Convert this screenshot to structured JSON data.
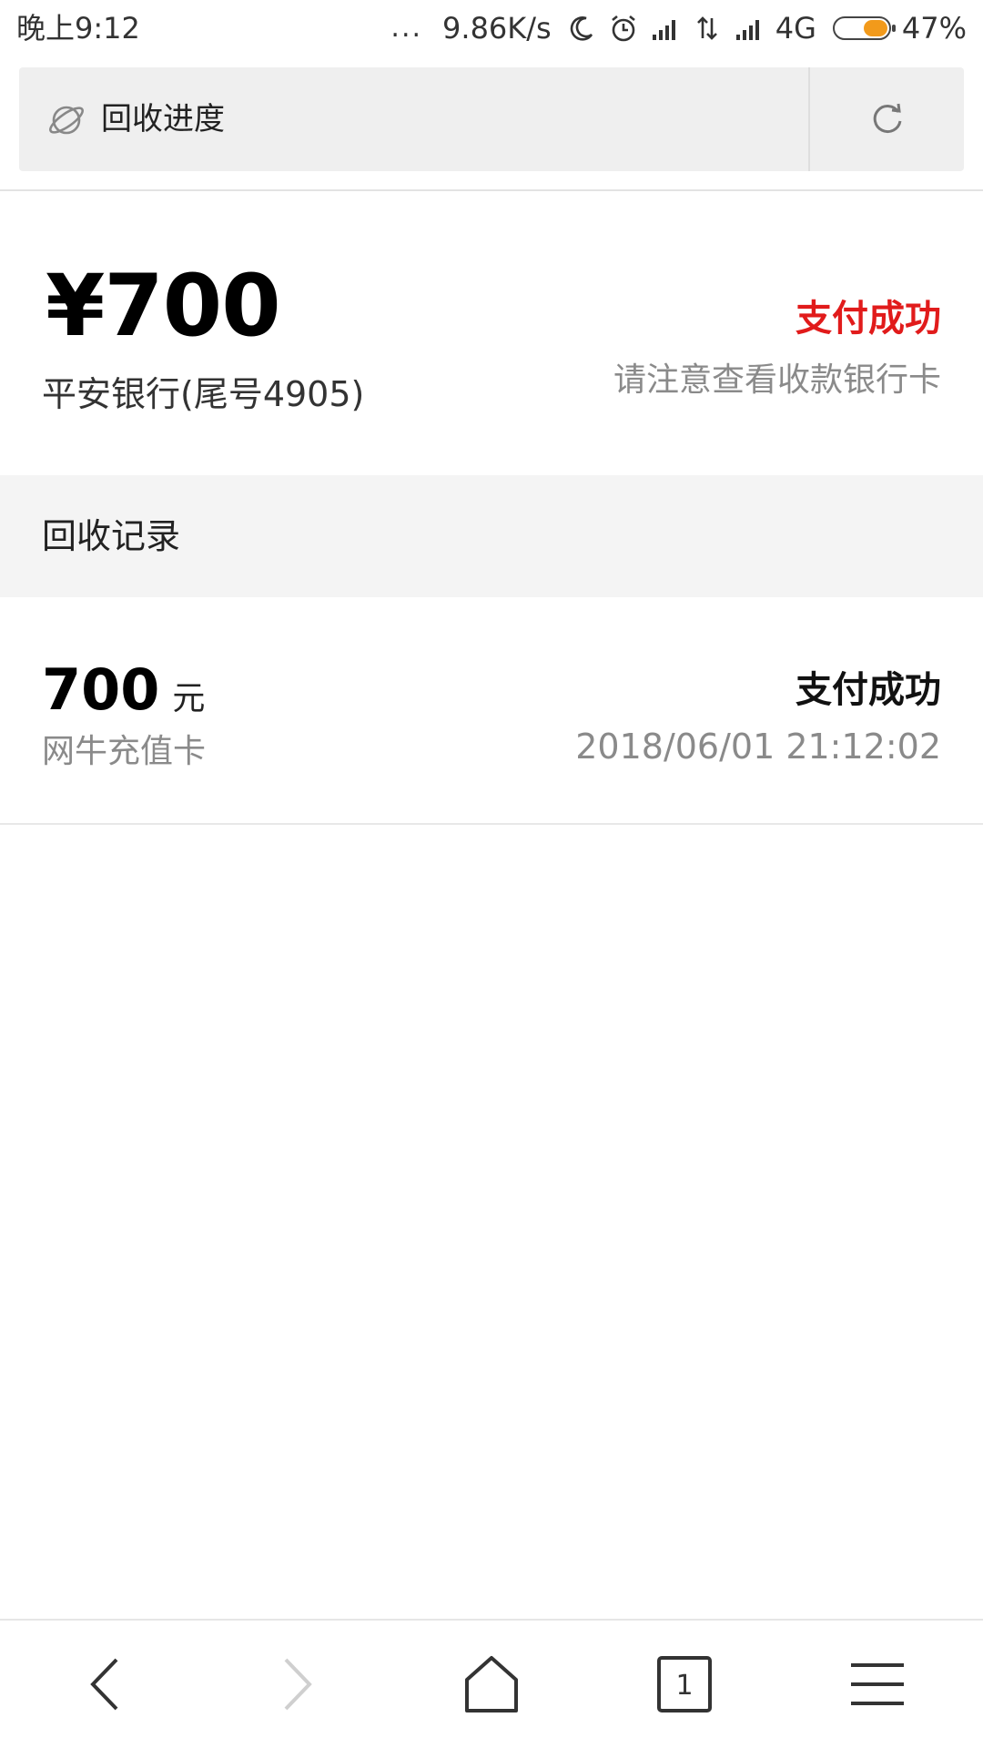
{
  "status_bar": {
    "time": "晚上9:12",
    "dots": "...",
    "net_speed": "9.86K/s",
    "network_type": "4G",
    "battery_percent": "47%",
    "battery_level": 0.47,
    "icons": [
      "moon-icon",
      "alarm-icon",
      "signal-icon",
      "data-transfer-icon",
      "signal-icon",
      "battery-icon"
    ]
  },
  "address_bar": {
    "title": "回收进度",
    "icons": [
      "globe-icon",
      "refresh-icon"
    ]
  },
  "summary": {
    "amount": "¥700",
    "bank": "平安银行(尾号4905)",
    "status": "支付成功",
    "notice": "请注意查看收款银行卡",
    "status_color": "#e11b1b"
  },
  "records": {
    "title": "回收记录",
    "items": [
      {
        "amount": "700",
        "unit": "元",
        "card_type": "网牛充值卡",
        "status": "支付成功",
        "time": "2018/06/01 21:12:02"
      }
    ]
  },
  "bottom_nav": {
    "tab_count": "1",
    "icons": [
      "back-icon",
      "forward-icon",
      "home-icon",
      "tabs-icon",
      "menu-icon"
    ]
  }
}
